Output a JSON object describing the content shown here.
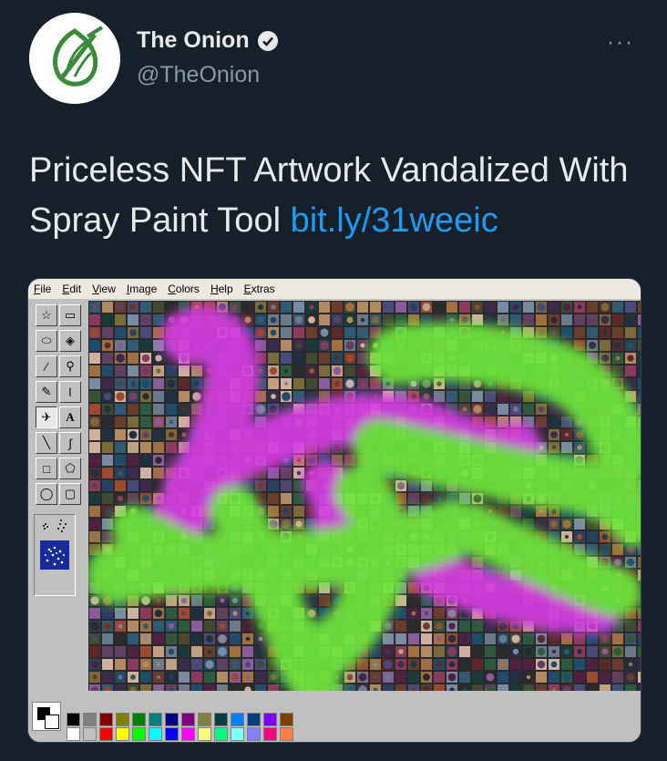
{
  "tweet": {
    "author_name": "The Onion",
    "author_handle": "@TheOnion",
    "more_label": "···",
    "text": "Priceless NFT Artwork Vandalized With Spray Paint Tool ",
    "link": "bit.ly/31weeic",
    "avatar_icon": "onion-logo-icon",
    "verified_icon": "verified-badge-icon"
  },
  "paint": {
    "menu": [
      "File",
      "Edit",
      "View",
      "Image",
      "Colors",
      "Help",
      "Extras"
    ],
    "tools": [
      "free-form-select-icon",
      "rect-select-icon",
      "eraser-icon",
      "fill-bucket-icon",
      "color-picker-icon",
      "magnifier-icon",
      "pencil-icon",
      "brush-icon",
      "airbrush-icon",
      "text-tool-icon",
      "line-icon",
      "curve-icon",
      "rectangle-icon",
      "polygon-icon",
      "ellipse-icon",
      "rounded-rect-icon"
    ],
    "text_tool_label": "A",
    "active_tool": "airbrush-icon",
    "palette_top": [
      "#000000",
      "#808080",
      "#800000",
      "#808000",
      "#008000",
      "#008080",
      "#000080",
      "#800080",
      "#808040",
      "#004040",
      "#0080ff",
      "#004080",
      "#8000ff",
      "#804000"
    ],
    "palette_bottom": [
      "#ffffff",
      "#c0c0c0",
      "#ff0000",
      "#ffff00",
      "#00ff00",
      "#00ffff",
      "#0000ff",
      "#ff00ff",
      "#ffff80",
      "#00ff80",
      "#80ffff",
      "#8080ff",
      "#ff0080",
      "#ff8040"
    ],
    "spray_colors": {
      "magenta": "#d53ce0",
      "green": "#6ee63a"
    },
    "foreground_color": "#000000",
    "background_color": "#ffffff"
  }
}
